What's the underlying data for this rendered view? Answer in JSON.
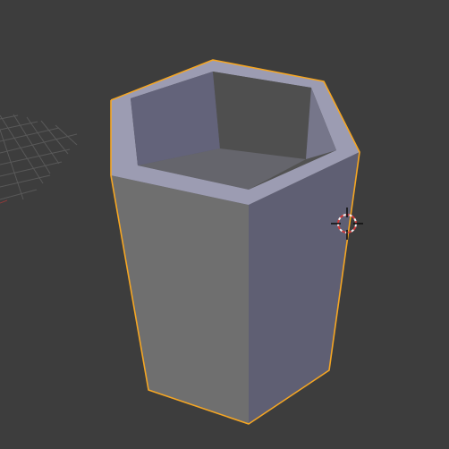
{
  "viewport": {
    "editor": "3D Viewport",
    "background_color": "#3d3d3d",
    "grid_color": "#5a5a5a",
    "selected_outline_color": "#f5a623"
  },
  "scene": {
    "object": {
      "shape": "hexagonal hollow cup",
      "selected": true,
      "face_colors": {
        "front_left_face": "#6f6f6f",
        "front_right_face": "#5f5f73",
        "rim_top": "#9c9cb2",
        "inner_wall_dark": "#4f4f4f",
        "inner_wall_light": "#76768a"
      }
    },
    "cursor": {
      "icon": "3d-cursor-icon",
      "ring_colors": [
        "#d23b3b",
        "#f2f2f2"
      ]
    },
    "grid": {
      "visible": true
    }
  }
}
